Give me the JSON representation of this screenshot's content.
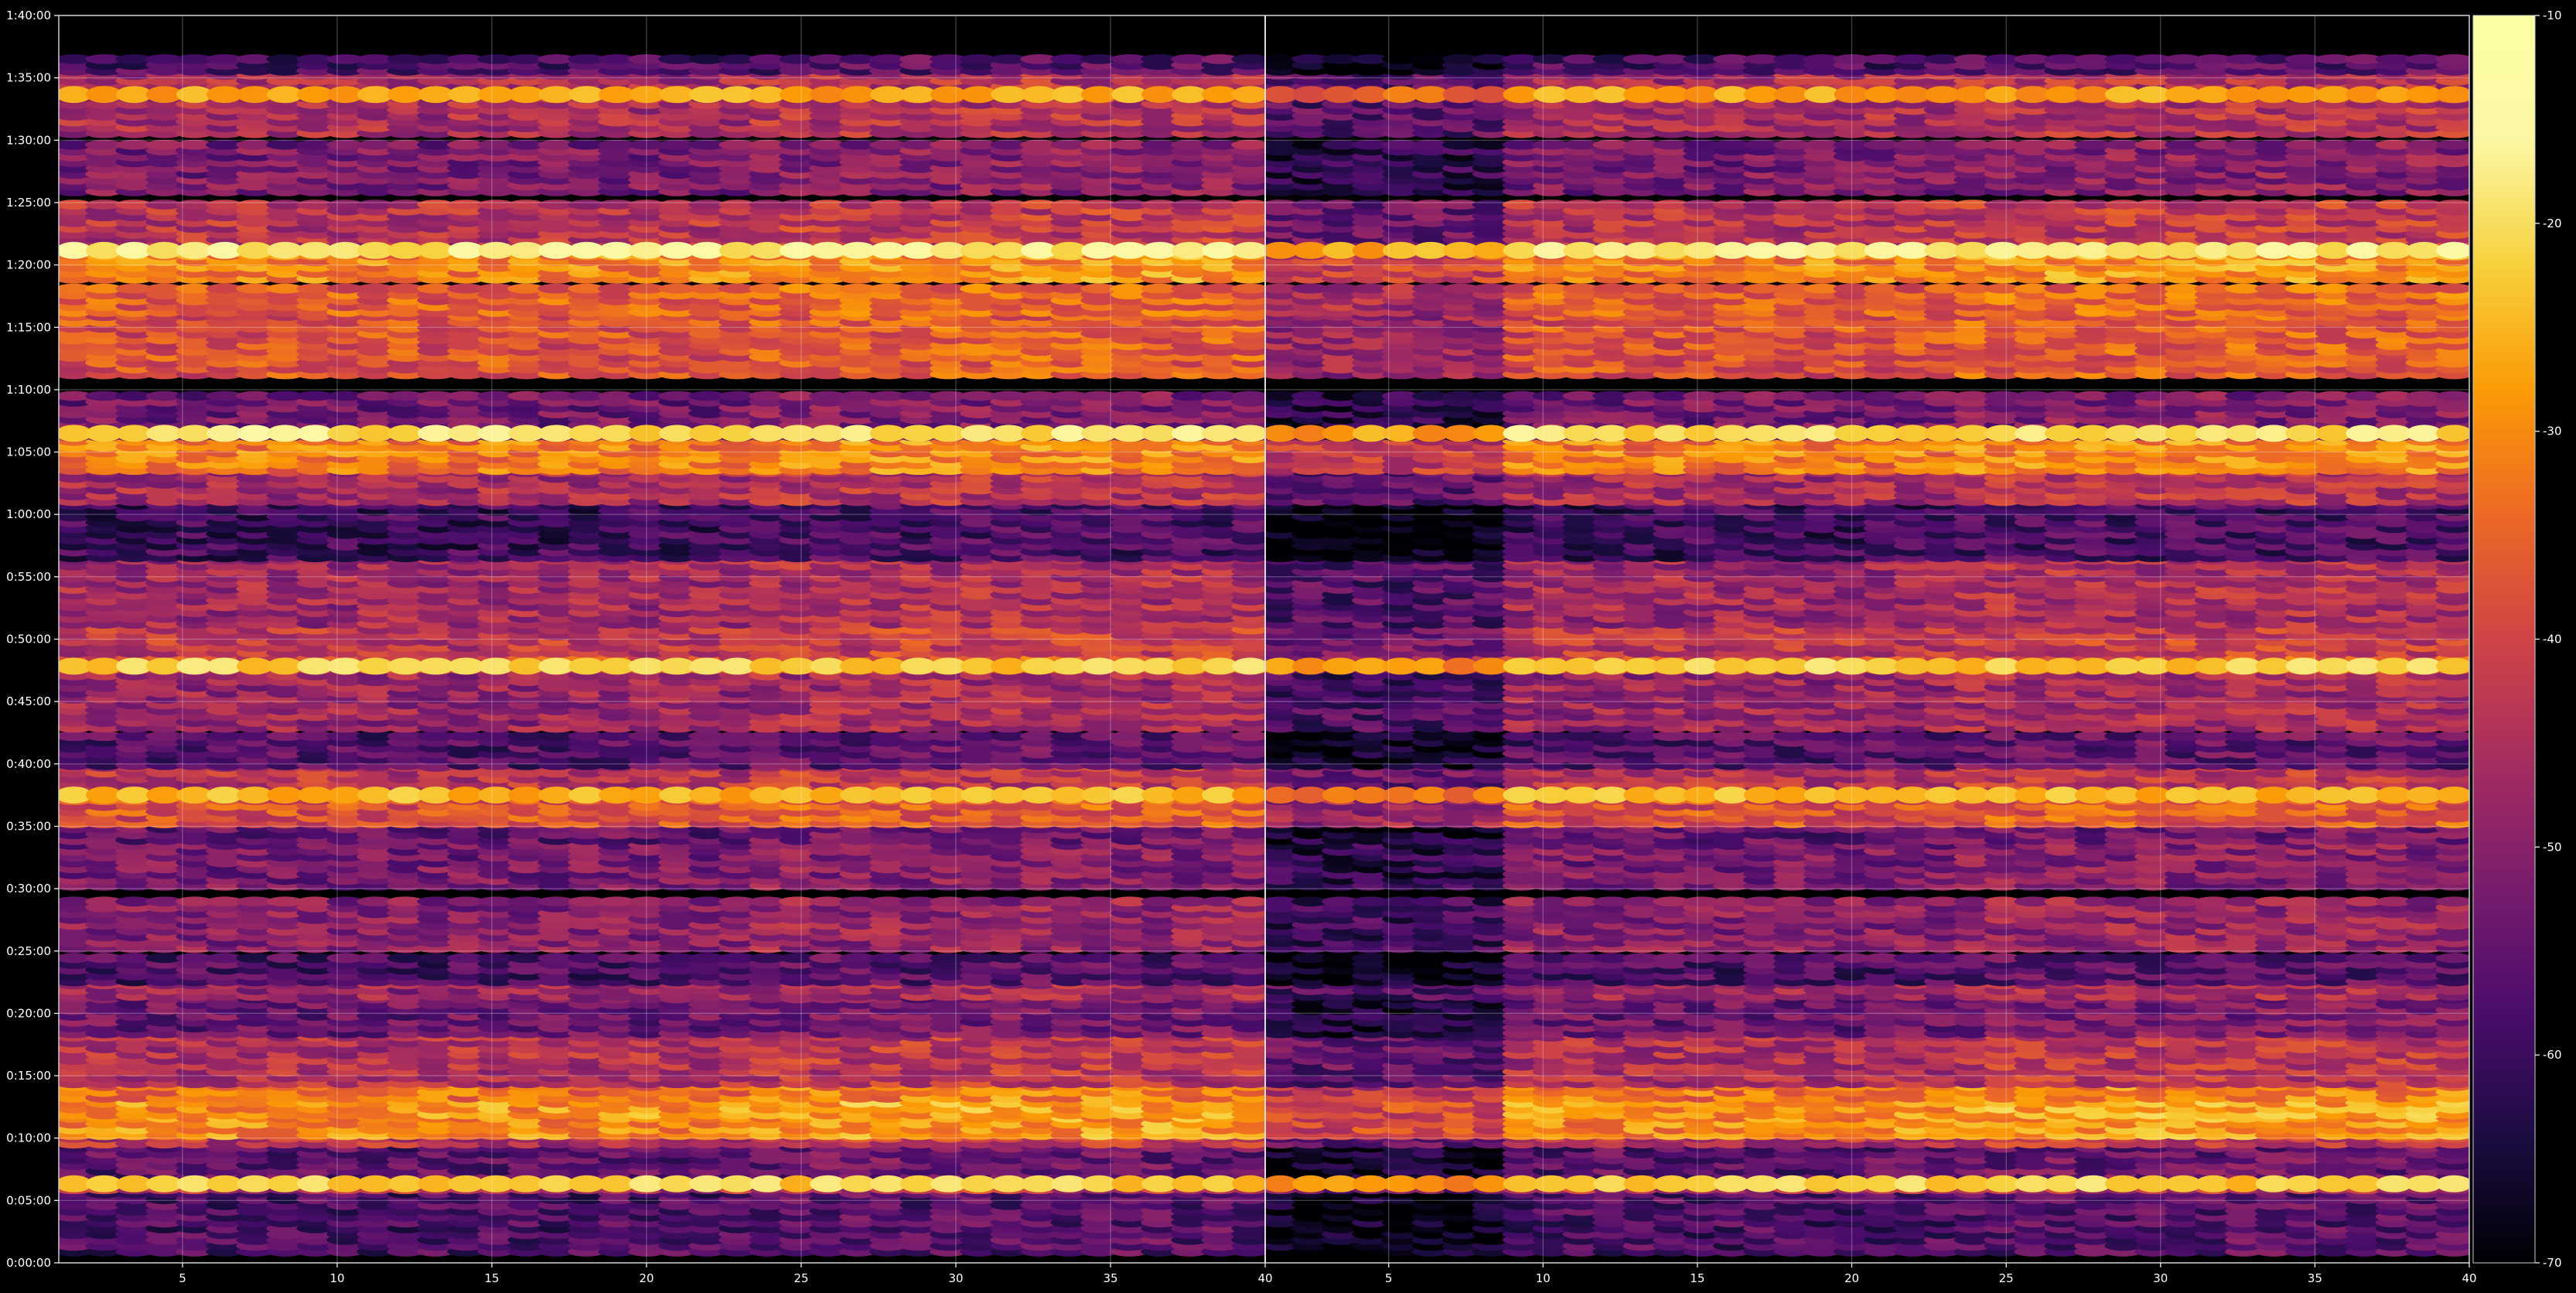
{
  "chart_data": {
    "type": "heatmap",
    "colormap": "inferno",
    "background": "#000000",
    "grid": true,
    "title": "",
    "xlabel": "",
    "ylabel": "",
    "panels": [
      {
        "name": "",
        "xlim": [
          1,
          40
        ],
        "x_ticks": [
          5,
          10,
          15,
          20,
          25,
          30,
          35,
          40
        ],
        "x_tick_labels": [
          "5",
          "10",
          "15",
          "20",
          "25",
          "30",
          "35",
          "40"
        ]
      },
      {
        "name": "",
        "xlim": [
          1,
          40
        ],
        "x_ticks": [
          5,
          10,
          15,
          20,
          25,
          30,
          35,
          40
        ],
        "x_tick_labels": [
          "5",
          "10",
          "15",
          "20",
          "25",
          "30",
          "35",
          "40"
        ]
      }
    ],
    "y_axis": {
      "units": "time (h:mm:ss)",
      "ylim_seconds": [
        0,
        6000
      ],
      "tick_seconds": [
        0,
        300,
        600,
        900,
        1200,
        1500,
        1800,
        2100,
        2400,
        2700,
        3000,
        3300,
        3600,
        3900,
        4200,
        4500,
        4800,
        5100,
        5400,
        5700,
        6000
      ],
      "tick_labels": [
        "0:00:00",
        "0:05:00",
        "0:10:00",
        "0:15:00",
        "0:20:00",
        "0:25:00",
        "0:30:00",
        "0:35:00",
        "0:40:00",
        "0:45:00",
        "0:50:00",
        "0:55:00",
        "1:00:00",
        "1:05:00",
        "1:10:00",
        "1:15:00",
        "1:20:00",
        "1:25:00",
        "1:30:00",
        "1:35:00",
        "1:40:00"
      ]
    },
    "colorbar": {
      "range": [
        -70,
        -10
      ],
      "ticks": [
        -70,
        -60,
        -50,
        -40,
        -30,
        -20,
        -10
      ],
      "tick_labels": [
        "-70",
        "-60",
        "-50",
        "-40",
        "-30",
        "-20",
        "-10"
      ],
      "position": "right"
    },
    "bands": [
      {
        "t0": 40,
        "t1": 330,
        "level": -58
      },
      {
        "t0": 340,
        "t1": 400,
        "level": -45
      },
      {
        "t0": 400,
        "t1": 560,
        "level": -56
      },
      {
        "t0": 560,
        "t1": 610,
        "level": -44
      },
      {
        "t0": 600,
        "t1": 700,
        "level": -30
      },
      {
        "t0": 700,
        "t1": 780,
        "level": -29
      },
      {
        "t0": 780,
        "t1": 850,
        "level": -33
      },
      {
        "t0": 850,
        "t1": 1080,
        "level": -45
      },
      {
        "t0": 1090,
        "t1": 1260,
        "level": -54
      },
      {
        "t0": 1270,
        "t1": 1340,
        "level": -48
      },
      {
        "t0": 1340,
        "t1": 1460,
        "level": -58
      },
      {
        "t0": 1500,
        "t1": 1740,
        "level": -50
      },
      {
        "t0": 1800,
        "t1": 2000,
        "level": -52
      },
      {
        "t0": 2020,
        "t1": 2100,
        "level": -55
      },
      {
        "t0": 2100,
        "t1": 2220,
        "level": -38
      },
      {
        "t0": 2260,
        "t1": 2380,
        "level": -44
      },
      {
        "t0": 2380,
        "t1": 2540,
        "level": -57
      },
      {
        "t0": 2560,
        "t1": 2840,
        "level": -48
      },
      {
        "t0": 2840,
        "t1": 2920,
        "level": -38
      },
      {
        "t0": 2920,
        "t1": 3060,
        "level": -43
      },
      {
        "t0": 3060,
        "t1": 3380,
        "level": -47
      },
      {
        "t0": 3380,
        "t1": 3640,
        "level": -60
      },
      {
        "t0": 3650,
        "t1": 3800,
        "level": -46
      },
      {
        "t0": 3800,
        "t1": 3960,
        "level": -32
      },
      {
        "t0": 3960,
        "t1": 4160,
        "level": -53
      },
      {
        "t0": 4260,
        "t1": 4560,
        "level": -38
      },
      {
        "t0": 4560,
        "t1": 4700,
        "level": -36
      },
      {
        "t0": 4720,
        "t1": 4860,
        "level": -31
      },
      {
        "t0": 4880,
        "t1": 5100,
        "level": -44
      },
      {
        "t0": 5140,
        "t1": 5380,
        "level": -52
      },
      {
        "t0": 5420,
        "t1": 5720,
        "level": -46
      },
      {
        "t0": 5720,
        "t1": 5800,
        "level": -58
      }
    ],
    "hot_lines": [
      {
        "t": 4870,
        "level": -18
      },
      {
        "t": 3990,
        "level": -20
      },
      {
        "t": 2870,
        "level": -22
      },
      {
        "t": 2250,
        "level": -25
      },
      {
        "t": 380,
        "level": -22
      },
      {
        "t": 5620,
        "level": -27
      }
    ]
  }
}
